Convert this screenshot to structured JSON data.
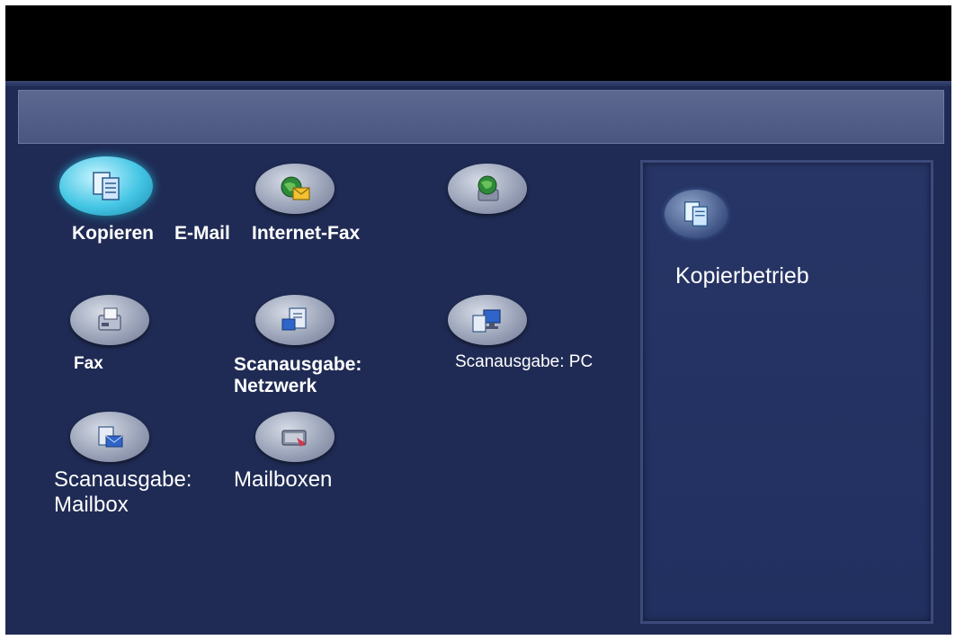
{
  "services": [
    {
      "id": "kopieren",
      "label": "Kopieren",
      "icon": "copy-icon",
      "active": true
    },
    {
      "id": "email",
      "label": "E-Mail",
      "icon": "email-icon",
      "active": false
    },
    {
      "id": "internetfax",
      "label": "Internet-Fax",
      "icon": "internet-fax-icon",
      "active": false
    },
    {
      "id": "fax",
      "label": "Fax",
      "icon": "fax-icon",
      "active": false
    },
    {
      "id": "scan-netzwerk",
      "label_line1": "Scanausgabe:",
      "label_line2": "Netzwerk",
      "icon": "scan-network-icon",
      "active": false
    },
    {
      "id": "scan-pc",
      "label": "Scanausgabe: PC",
      "icon": "scan-pc-icon",
      "active": false
    },
    {
      "id": "scan-mailbox",
      "label_line1": "Scanausgabe:",
      "label_line2": "Mailbox",
      "icon": "scan-mailbox-icon",
      "active": false
    },
    {
      "id": "mailboxen",
      "label": "Mailboxen",
      "icon": "mailboxes-icon",
      "active": false
    }
  ],
  "panel": {
    "selected_label": "Kopierbetrieb",
    "icon": "copy-icon"
  },
  "colors": {
    "background": "#1f2b54",
    "active_button": "#44c6e4",
    "button": "#9aa3b8"
  }
}
